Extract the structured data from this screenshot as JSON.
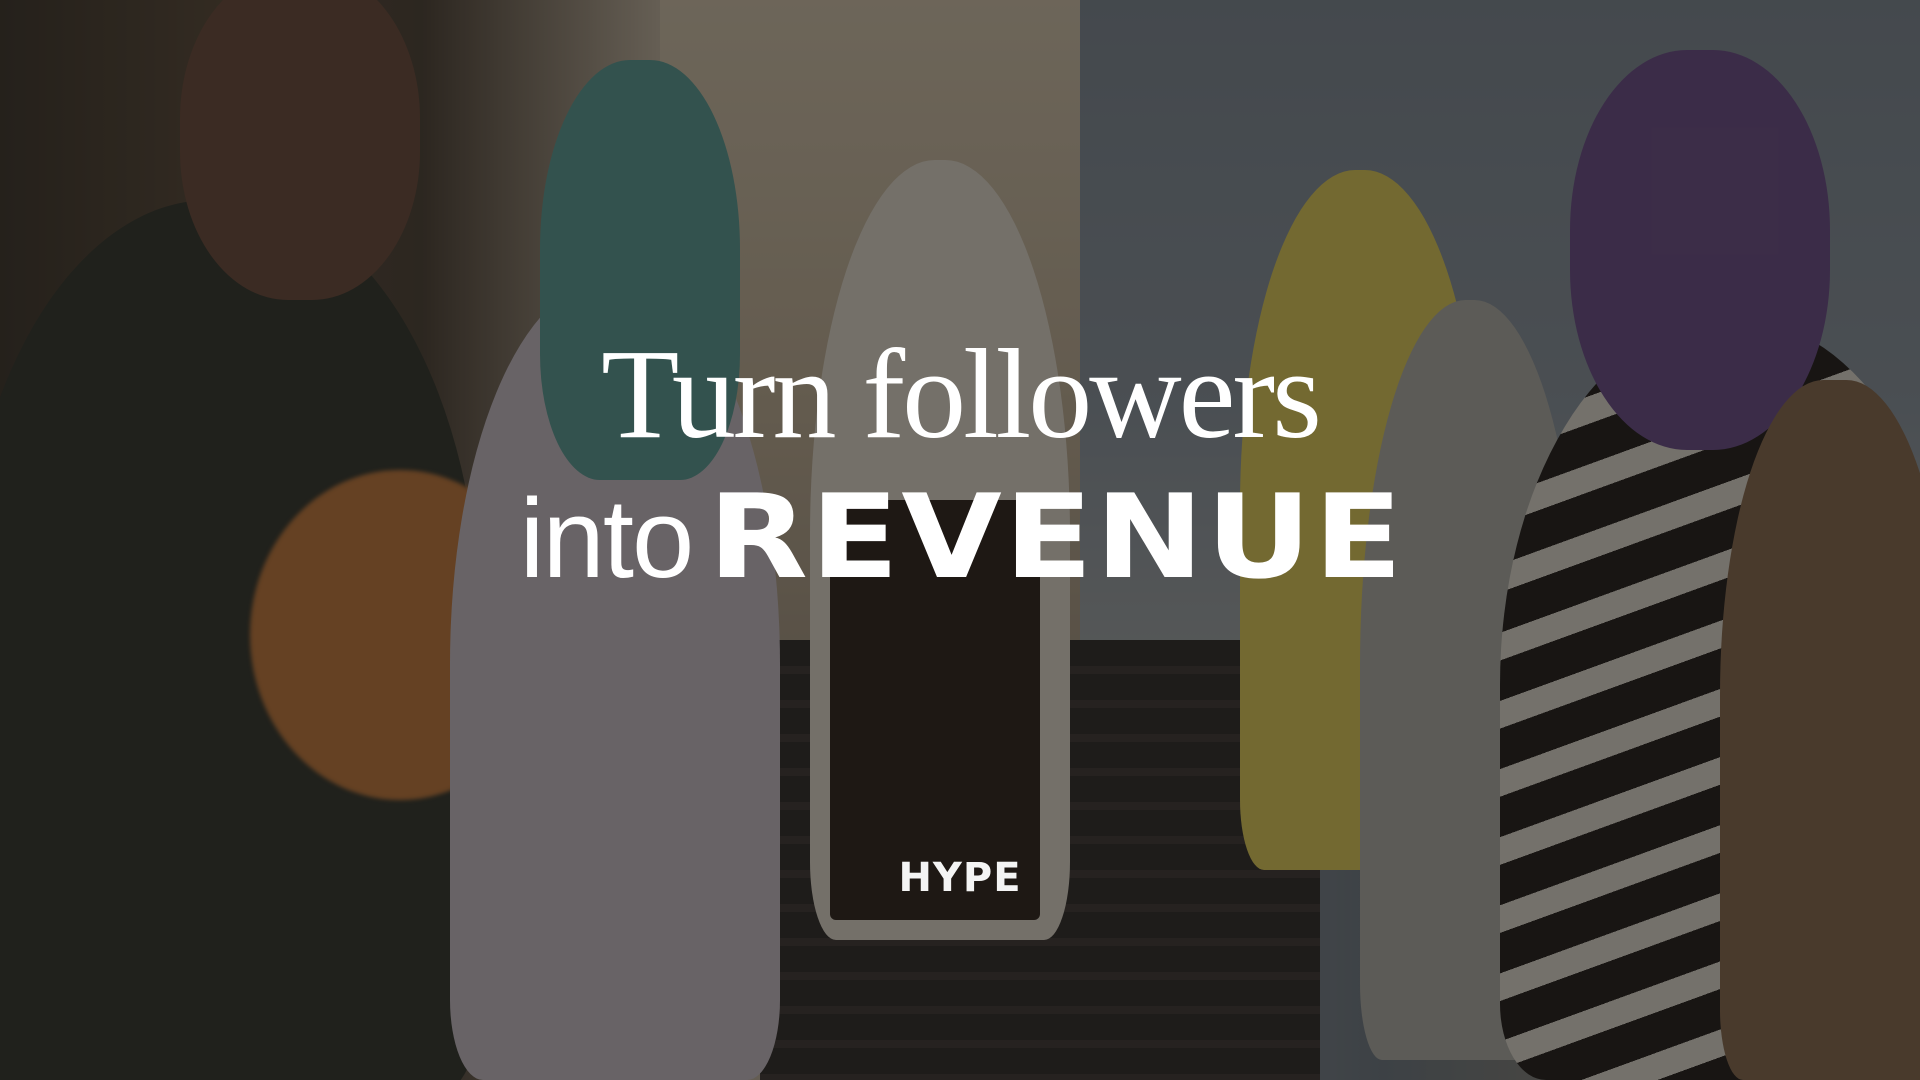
{
  "hero": {
    "title_line1": "Turn followers",
    "title_line2_light": "into",
    "title_line2_bold": "REVENUE",
    "brand_logo": "HYPE"
  },
  "colors": {
    "overlay": "#141210",
    "text": "#ffffff"
  }
}
